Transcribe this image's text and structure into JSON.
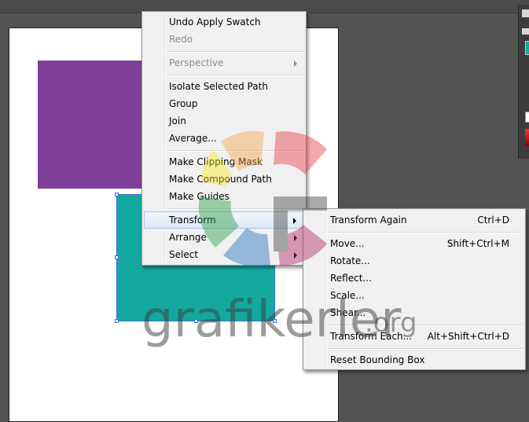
{
  "context_menu": {
    "items": [
      {
        "label": "Undo Apply Swatch",
        "disabled": false
      },
      {
        "label": "Redo",
        "disabled": true
      },
      {
        "label": "Perspective",
        "disabled": true,
        "submenu": true
      },
      {
        "label": "Isolate Selected Path",
        "disabled": false
      },
      {
        "label": "Group",
        "disabled": false
      },
      {
        "label": "Join",
        "disabled": false
      },
      {
        "label": "Average...",
        "disabled": false
      },
      {
        "label": "Make Clipping Mask",
        "disabled": false
      },
      {
        "label": "Make Compound Path",
        "disabled": false
      },
      {
        "label": "Make Guides",
        "disabled": false
      },
      {
        "label": "Transform",
        "disabled": false,
        "submenu": true,
        "highlighted": true
      },
      {
        "label": "Arrange",
        "disabled": false,
        "submenu": true
      },
      {
        "label": "Select",
        "disabled": false,
        "submenu": true
      }
    ]
  },
  "transform_submenu": {
    "items": [
      {
        "label": "Transform Again",
        "shortcut": "Ctrl+D"
      },
      {
        "label": "Move...",
        "shortcut": "Shift+Ctrl+M"
      },
      {
        "label": "Rotate...",
        "shortcut": ""
      },
      {
        "label": "Reflect...",
        "shortcut": ""
      },
      {
        "label": "Scale...",
        "shortcut": ""
      },
      {
        "label": "Shear...",
        "shortcut": ""
      },
      {
        "label": "Transform Each...",
        "shortcut": "Alt+Shift+Ctrl+D"
      },
      {
        "label": "Reset Bounding Box",
        "shortcut": ""
      }
    ]
  },
  "watermark": {
    "text": "grafikerler",
    "suffix": ".org"
  },
  "colors": {
    "canvas_bg": "#535353",
    "artboard": "#ffffff",
    "purple_rect": "#7e3f98",
    "teal_rect": "#13a99f",
    "selection": "#3a6fd8",
    "menu_bg": "#f0f0f0"
  }
}
